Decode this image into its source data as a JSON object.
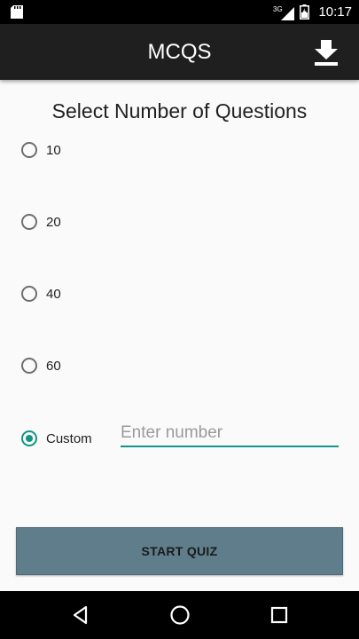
{
  "status_bar": {
    "time": "10:17",
    "network": "3G",
    "icons": [
      "sd-card-icon",
      "signal-icon",
      "battery-icon"
    ]
  },
  "app_bar": {
    "title": "MCQS",
    "action_icon": "download-icon"
  },
  "main": {
    "heading": "Select Number of Questions",
    "options": [
      {
        "label": "10",
        "checked": false
      },
      {
        "label": "20",
        "checked": false
      },
      {
        "label": "40",
        "checked": false
      },
      {
        "label": "60",
        "checked": false
      },
      {
        "label": "Custom",
        "checked": true
      }
    ],
    "custom_input": {
      "value": "",
      "placeholder": "Enter number"
    },
    "start_button_label": "START QUIZ"
  },
  "nav_bar": {
    "icons": [
      "back-icon",
      "home-icon",
      "recents-icon"
    ]
  },
  "colors": {
    "accent": "#139584",
    "app_bar": "#1f1f1f",
    "button": "#607d8b",
    "background": "#fafafa"
  }
}
